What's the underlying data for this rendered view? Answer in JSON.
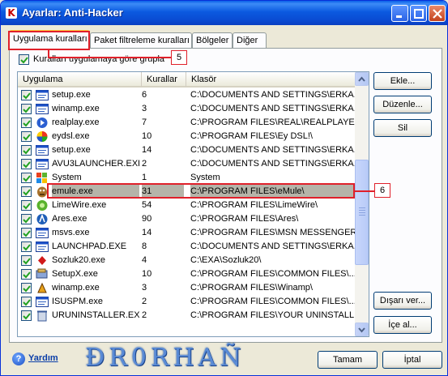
{
  "window": {
    "title": "Ayarlar: Anti-Hacker",
    "app_icon": "K"
  },
  "tabs": [
    {
      "label": "Uygulama kuralları",
      "active": true
    },
    {
      "label": "Paket filtreleme kuralları",
      "active": false
    },
    {
      "label": "Bölgeler",
      "active": false
    },
    {
      "label": "Diğer",
      "active": false
    }
  ],
  "group_checkbox": {
    "label": "Kuralları uygulamaya göre grupla",
    "checked": true
  },
  "callouts": {
    "tab_marker": "5",
    "row_marker": "6",
    "color": "#e0202a"
  },
  "columns": {
    "app": "Uygulama",
    "rules": "Kurallar",
    "folder": "Klasör"
  },
  "rows": [
    {
      "icon": "window-icon",
      "name": "setup.exe",
      "rules": "6",
      "folder": "C:\\DOCUMENTS AND SETTINGS\\ERKA..."
    },
    {
      "icon": "window-icon",
      "name": "winamp.exe",
      "rules": "3",
      "folder": "C:\\DOCUMENTS AND SETTINGS\\ERKA..."
    },
    {
      "icon": "realplayer-icon",
      "name": "realplay.exe",
      "rules": "7",
      "folder": "C:\\PROGRAM FILES\\REAL\\REALPLAYER\\"
    },
    {
      "icon": "color-wheel-icon",
      "name": "eydsl.exe",
      "rules": "10",
      "folder": "C:\\PROGRAM FILES\\Ey DSL!\\"
    },
    {
      "icon": "window-icon",
      "name": "setup.exe",
      "rules": "14",
      "folder": "C:\\DOCUMENTS AND SETTINGS\\ERKA..."
    },
    {
      "icon": "window-icon",
      "name": "AVU3LAUNCHER.EXE",
      "rules": "2",
      "folder": "C:\\DOCUMENTS AND SETTINGS\\ERKA..."
    },
    {
      "icon": "windows-logo-icon",
      "name": "System",
      "rules": "1",
      "folder": "System"
    },
    {
      "icon": "emule-icon",
      "name": "emule.exe",
      "rules": "31",
      "folder": "C:\\PROGRAM FILES\\eMule\\",
      "selected": true
    },
    {
      "icon": "limewire-icon",
      "name": "LimeWire.exe",
      "rules": "54",
      "folder": "C:\\PROGRAM FILES\\LimeWire\\"
    },
    {
      "icon": "ares-icon",
      "name": "Ares.exe",
      "rules": "90",
      "folder": "C:\\PROGRAM FILES\\Ares\\"
    },
    {
      "icon": "window-icon",
      "name": "msvs.exe",
      "rules": "14",
      "folder": "C:\\PROGRAM FILES\\MSN MESSENGER\\"
    },
    {
      "icon": "window-icon",
      "name": "LAUNCHPAD.EXE",
      "rules": "8",
      "folder": "C:\\DOCUMENTS AND SETTINGS\\ERKA..."
    },
    {
      "icon": "sozluk-icon",
      "name": "Sozluk20.exe",
      "rules": "4",
      "folder": "C:\\EXA\\Sozluk20\\"
    },
    {
      "icon": "setupx-icon",
      "name": "SetupX.exe",
      "rules": "10",
      "folder": "C:\\PROGRAM FILES\\COMMON FILES\\..."
    },
    {
      "icon": "winamp-icon",
      "name": "winamp.exe",
      "rules": "3",
      "folder": "C:\\PROGRAM FILES\\Winamp\\"
    },
    {
      "icon": "window-icon",
      "name": "ISUSPM.exe",
      "rules": "2",
      "folder": "C:\\PROGRAM FILES\\COMMON FILES\\..."
    },
    {
      "icon": "recycle-icon",
      "name": "URUNINSTALLER.EXE",
      "rules": "2",
      "folder": "C:\\PROGRAM FILES\\YOUR UNINSTALL..."
    }
  ],
  "side_buttons": {
    "add": "Ekle...",
    "edit": "Düzenle...",
    "delete": "Sil",
    "export": "Dışarı ver...",
    "import": "İçe al..."
  },
  "footer": {
    "help": "Yardım",
    "brand": "ÐR0RHAÑ",
    "ok": "Tamam",
    "cancel": "İptal"
  }
}
